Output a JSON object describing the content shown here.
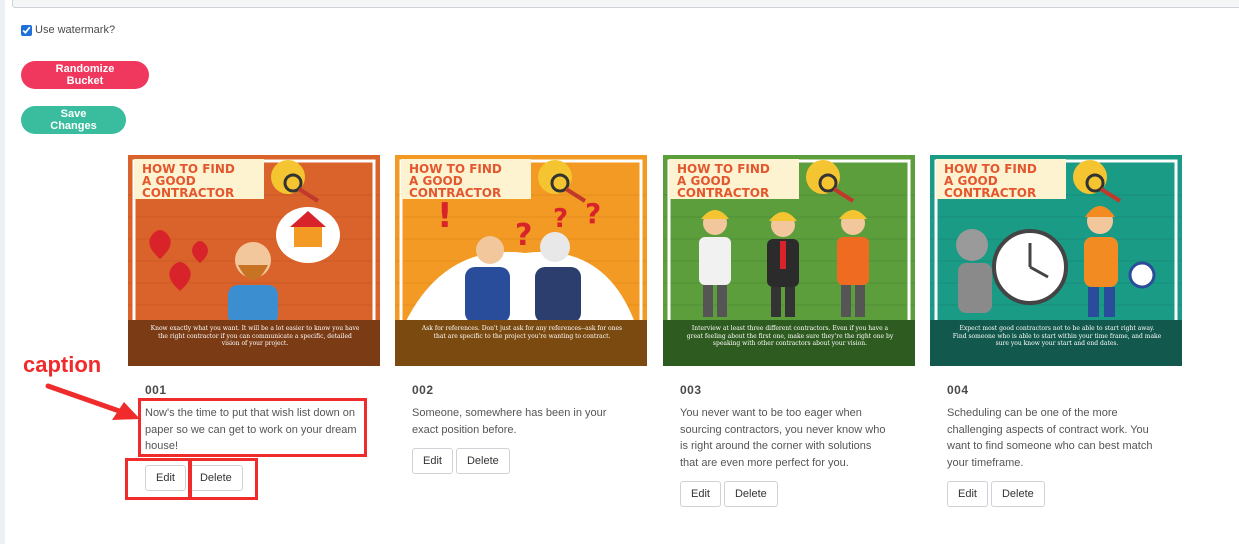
{
  "settings": {
    "watermark_label": "Use watermark?",
    "watermark_checked": true,
    "randomize_label": "Randomize Bucket",
    "save_label": "Save Changes"
  },
  "colors": {
    "randomize_button": "#f0385e",
    "save_button": "#39bd9e",
    "annotation": "#ef2b2b",
    "card_backgrounds": [
      "#d9632b",
      "#f29a23",
      "#5c9d3c",
      "#1a9b86"
    ]
  },
  "cards": [
    {
      "number": "001",
      "image_title": "HOW TO FIND A GOOD CONTRACTOR",
      "image_caption": "Know exactly what you want. It will be a lot easier to know you have the right contractor if you can communicate a specific, detailed vision of your project.",
      "caption": "Now's the time to put that wish list down on paper so we can get to work on your dream house!",
      "edit_label": "Edit",
      "delete_label": "Delete"
    },
    {
      "number": "002",
      "image_title": "HOW TO FIND A GOOD CONTRACTOR",
      "image_caption": "Ask for references. Don't just ask for any references--ask for ones that are specific to the project you're wanting to contract.",
      "caption": "Someone, somewhere has been in your exact position before.",
      "edit_label": "Edit",
      "delete_label": "Delete"
    },
    {
      "number": "003",
      "image_title": "HOW TO FIND A GOOD CONTRACTOR",
      "image_caption": "Interview at least three different contractors. Even if you have a great feeling about the first one, make sure they're the right one by speaking with other contractors about your vision.",
      "caption": "You never want to be too eager when sourcing contractors, you never know who is right around the corner with solutions that are even more perfect for you.",
      "edit_label": "Edit",
      "delete_label": "Delete"
    },
    {
      "number": "004",
      "image_title": "HOW TO FIND A GOOD CONTRACTOR",
      "image_caption": "Expect most good contractors not to be able to start right away. Find someone who is able to start within your time frame, and make sure you know your start and end dates.",
      "caption": "Scheduling can be one of the more challenging aspects of contract work. You want to find someone who can best match your timeframe.",
      "edit_label": "Edit",
      "delete_label": "Delete"
    }
  ],
  "annotation": {
    "label": "caption"
  }
}
